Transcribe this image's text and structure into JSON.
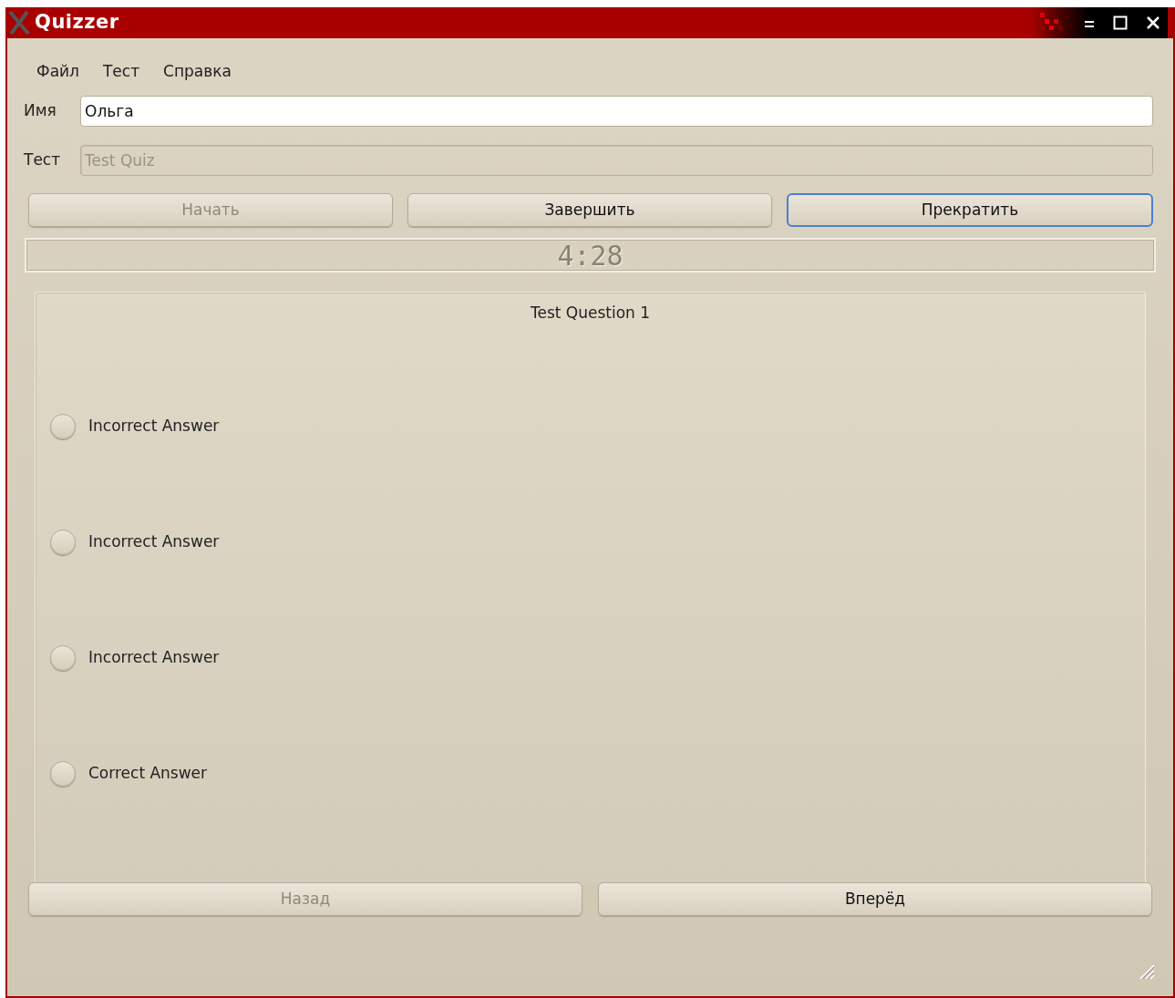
{
  "window": {
    "title": "Quizzer"
  },
  "menu": [
    "Файл",
    "Тест",
    "Справка"
  ],
  "fields": [
    {
      "label": "Имя",
      "value": "Ольга",
      "disabled": false
    },
    {
      "label": "Тест",
      "value": "Test Quiz",
      "disabled": true
    }
  ],
  "actions": [
    {
      "label": "Начать",
      "disabled": true,
      "focused": false
    },
    {
      "label": "Завершить",
      "disabled": false,
      "focused": false
    },
    {
      "label": "Прекратить",
      "disabled": false,
      "focused": true
    }
  ],
  "timer": "4:28",
  "question": {
    "title": "Test Question 1",
    "answers": [
      {
        "label": "Incorrect Answer",
        "selected": false
      },
      {
        "label": "Incorrect Answer",
        "selected": false
      },
      {
        "label": "Incorrect Answer",
        "selected": false
      },
      {
        "label": "Correct Answer",
        "selected": false
      }
    ]
  },
  "navigation": [
    {
      "label": "Назад",
      "disabled": true
    },
    {
      "label": "Вперёд",
      "disabled": false
    }
  ]
}
